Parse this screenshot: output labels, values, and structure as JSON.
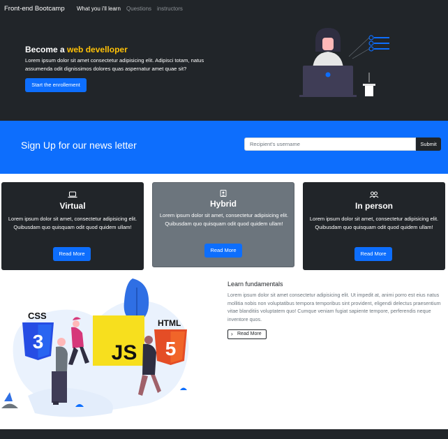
{
  "nav": {
    "brand": "Front-end Bootcamp",
    "links": [
      "What you i'll learn",
      "Questions",
      "instructors"
    ]
  },
  "hero": {
    "title_prefix": "Become a",
    "title_accent": "web develloper",
    "text": "Lorem ipsum dolor sit amet consectetur adipisicing elit. Adipisci totam, natus assumenda odit dignissimos dolores quas aspernatur amet quae sit?",
    "button": "Start the enrollement"
  },
  "newsletter": {
    "title": "Sign Up for our news letter",
    "placeholder": "Recipient's username",
    "submit": "Submit"
  },
  "cards": [
    {
      "icon": "laptop-icon",
      "title": "Virtual",
      "text": "Lorem ipsum dolor sit amet, consectetur adipisicing elit. Quibusdam quo quisquam odit quod quidem ullam!",
      "button": "Read More"
    },
    {
      "icon": "person-badge-icon",
      "title": "Hybrid",
      "text": "Lorem ipsum dolor sit amet, consectetur adipisicing elit. Quibusdam quo quisquam odit quod quidem ullam!",
      "button": "Read More"
    },
    {
      "icon": "people-icon",
      "title": "In person",
      "text": "Lorem ipsum dolor sit amet, consectetur adipisicing elit. Quibusdam quo quisquam odit quod quidem ullam!",
      "button": "Read More"
    }
  ],
  "learn": {
    "title": "Learn fundamentals",
    "text": "Lorem ipsum dolor sit amet consectetur adipisicing elit. Ut impedit at, animi porro est eius natus mollitia nobis non voluptatibus tempora temporibus sint provident, eligendi delectus praesentium vitae blanditiis voluptatem quo! Cumque veniam fugiat sapiente tempore, perferendis neque inventore quos.",
    "button": "Read More",
    "illustration_labels": [
      "CSS",
      "JS",
      "HTML"
    ]
  },
  "colors": {
    "dark": "#212529",
    "primary": "#0d6efd",
    "accent": "#ffc107",
    "gray": "#6c757d"
  }
}
